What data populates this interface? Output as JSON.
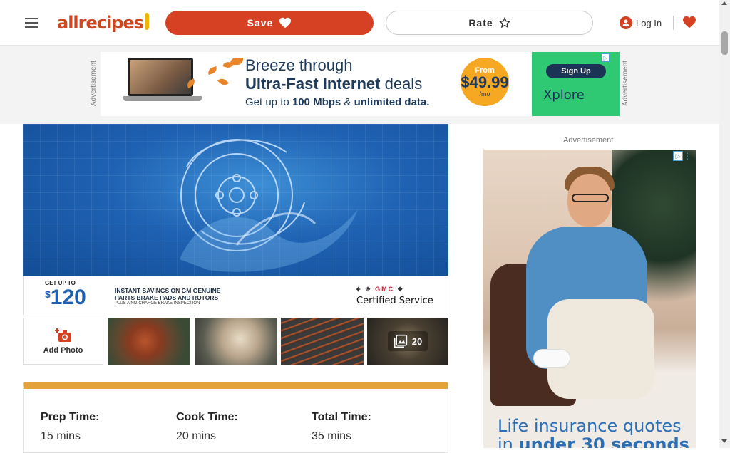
{
  "header": {
    "logo_text": "allrecipes",
    "save_label": "Save",
    "rate_label": "Rate",
    "login_label": "Log In"
  },
  "top_ad": {
    "side_label": "Advertisement",
    "headline_1": "Breeze through",
    "headline_2_bold": "Ultra-Fast Internet",
    "headline_2_rest": " deals",
    "sub_prefix": "Get up to ",
    "sub_bold_1": "100 Mbps",
    "sub_mid": " & ",
    "sub_bold_2": "unlimited data.",
    "price_from": "From",
    "price_value": "$49.99",
    "price_unit": "/mo",
    "signup_label": "Sign Up",
    "brand": "Xplore"
  },
  "video_ad": {
    "get_up_to": "GET UP TO",
    "price": "120",
    "instant_line1": "INSTANT SAVINGS ON GM GENUINE",
    "instant_line2": "PARTS BRAKE PADS AND ROTORS",
    "plus_line": "PLUS A NO-CHARGE BRAKE INSPECTION",
    "brands": "GMC",
    "certified": "Certified Service"
  },
  "thumbnails": {
    "add_photo_label": "Add Photo",
    "more_count": "20"
  },
  "recipe_details": {
    "items": [
      {
        "label": "Prep Time:",
        "value": "15 mins"
      },
      {
        "label": "Cook Time:",
        "value": "20 mins"
      },
      {
        "label": "Total Time:",
        "value": "35 mins"
      }
    ]
  },
  "right_ad": {
    "label": "Advertisement",
    "text_line1": "Life insurance quotes",
    "text_line2_prefix": "in ",
    "text_line2_bold": "under 30 seconds"
  },
  "colors": {
    "brand_orange": "#d54122",
    "accent_gold": "#e4a23b",
    "ad_green": "#2fc873"
  }
}
